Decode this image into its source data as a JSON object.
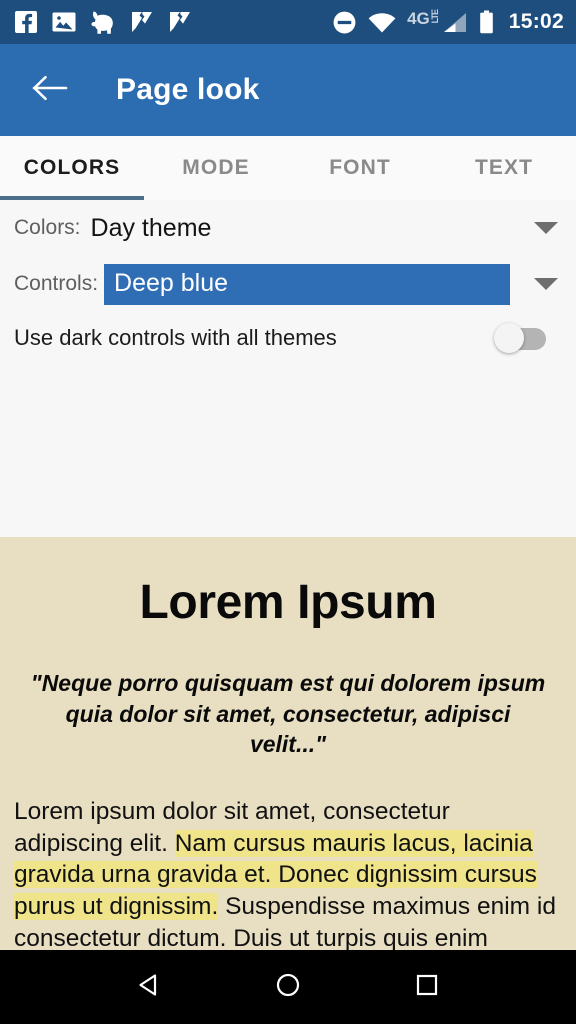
{
  "status_bar": {
    "background": "#1d4e7d",
    "time": "15:02",
    "network_label": "4G",
    "network_sub": "LTE",
    "icons": [
      "facebook-icon",
      "photo-icon",
      "dog-icon",
      "tasks-check-icon",
      "tasks-check-icon-2",
      "do-not-disturb-icon",
      "wifi-icon",
      "signal-icon",
      "battery-icon"
    ]
  },
  "app_bar": {
    "background": "#2c6cb0",
    "back_icon": "back-arrow-icon",
    "title": "Page look"
  },
  "tabs": {
    "active_index": 0,
    "indicator_color": "#4d6e8a",
    "items": [
      {
        "label": "COLORS"
      },
      {
        "label": "MODE"
      },
      {
        "label": "FONT"
      },
      {
        "label": "TEXT"
      }
    ]
  },
  "settings": {
    "background": "#f7f7f7",
    "colors_row": {
      "label": "Colors:",
      "value": "Day theme",
      "caret_icon": "chevron-down-icon"
    },
    "controls_row": {
      "label": "Controls:",
      "value": "Deep blue",
      "selected_background": "#2f6eb5",
      "caret_icon": "chevron-down-icon"
    },
    "dark_controls_row": {
      "label": "Use dark controls with all themes",
      "toggle_state": "off"
    }
  },
  "preview": {
    "background": "#e8dfc3",
    "highlight_color": "#efe48a",
    "title": "Lorem Ipsum",
    "quote": "\"Neque porro quisquam est qui dolorem ipsum quia dolor sit amet, consectetur, adipisci velit...\"",
    "body_before": "Lorem ipsum dolor sit amet, consectetur adipiscing elit. ",
    "body_highlighted": "Nam cursus mauris lacus, lacinia gravida urna gravida et. Donec dignissim cursus purus ut dignissim.",
    "body_after": " Suspendisse maximus enim id consectetur dictum. Duis ut turpis quis enim malesuada commodo quis ut sem. Fusce non"
  },
  "nav_bar": {
    "background": "#000000",
    "back_icon": "nav-back-triangle-icon",
    "home_icon": "nav-home-circle-icon",
    "recents_icon": "nav-recents-square-icon"
  }
}
